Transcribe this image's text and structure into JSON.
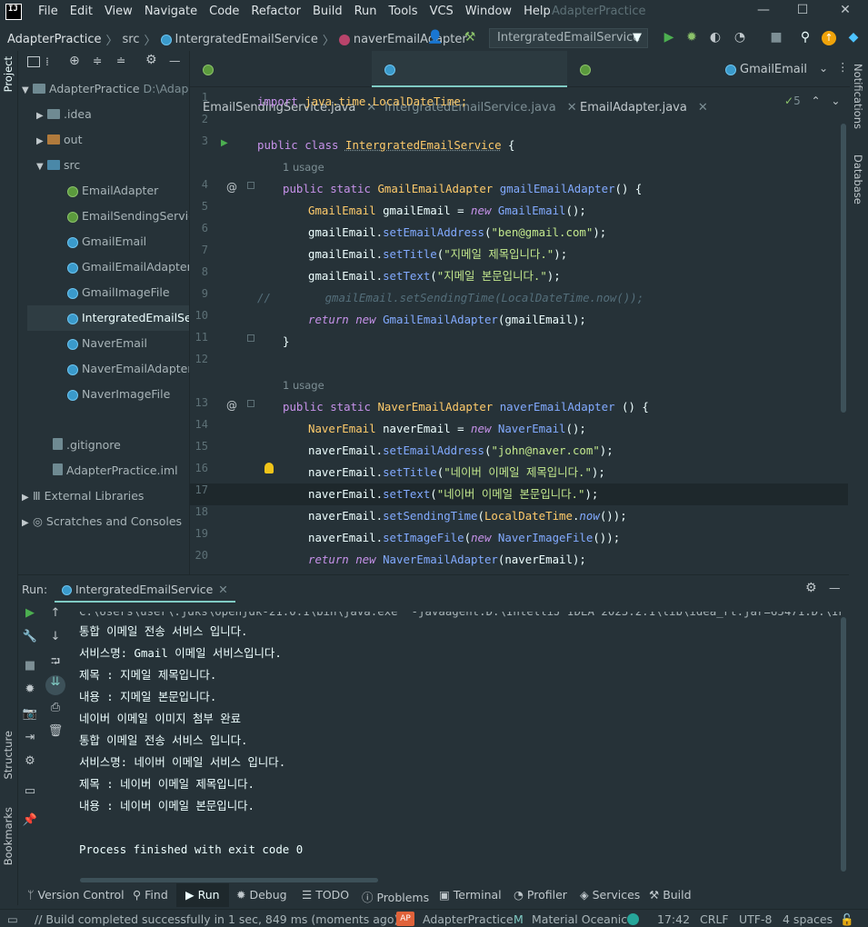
{
  "menubar": {
    "logo": "IJ",
    "items": [
      "File",
      "Edit",
      "View",
      "Navigate",
      "Code",
      "Refactor",
      "Build",
      "Run",
      "Tools",
      "VCS",
      "Window",
      "Help"
    ],
    "app_title": "AdapterPractice"
  },
  "breadcrumb": {
    "project": "AdapterPractice",
    "src": "src",
    "class": "IntergratedEmailService",
    "method": "naverEmailAdapter"
  },
  "run_config": {
    "label": "IntergratedEmailService"
  },
  "left_strip": {
    "project": "Project",
    "structure": "Structure",
    "bookmarks": "Bookmarks"
  },
  "right_strip": {
    "notifications": "Notifications",
    "database": "Database"
  },
  "project_tree": {
    "root": "AdapterPractice",
    "root_path": "D:\\Adap",
    "idea": ".idea",
    "out": "out",
    "src": "src",
    "files": [
      {
        "name": "EmailAdapter",
        "kind": "interface"
      },
      {
        "name": "EmailSendingService",
        "kind": "interface"
      },
      {
        "name": "GmailEmail",
        "kind": "class"
      },
      {
        "name": "GmailEmailAdapter",
        "kind": "class"
      },
      {
        "name": "GmailImageFile",
        "kind": "class"
      },
      {
        "name": "IntergratedEmailServic",
        "kind": "class"
      },
      {
        "name": "NaverEmail",
        "kind": "class"
      },
      {
        "name": "NaverEmailAdapter",
        "kind": "class"
      },
      {
        "name": "NaverImageFile",
        "kind": "class"
      }
    ],
    "gitignore": ".gitignore",
    "iml": "AdapterPractice.iml",
    "ext_libs": "External Libraries",
    "scratches": "Scratches and Consoles"
  },
  "tabs": [
    {
      "label": "EmailSendingService.java"
    },
    {
      "label": "IntergratedEmailService.java"
    },
    {
      "label": "EmailAdapter.java"
    },
    {
      "label": "GmailEmail"
    }
  ],
  "editor": {
    "inspection_count": "5",
    "line_numbers": [
      "1",
      "2",
      "3",
      "4",
      "5",
      "6",
      "7",
      "8",
      "9",
      "10",
      "11",
      "12",
      "13",
      "14",
      "15",
      "16",
      "17",
      "18",
      "19",
      "20"
    ],
    "usage_hint": "1 usage",
    "lines": {
      "l1a": "import ",
      "l1b": "java.time.LocalDateTime;",
      "l3a": "public class ",
      "l3b": "IntergratedEmailService",
      "l3c": " {",
      "l4a": "public static ",
      "l4b": "GmailEmailAdapter ",
      "l4c": "gmailEmailAdapter",
      "l4d": "() {",
      "l5a": "GmailEmail ",
      "l5b": "gmailEmail = ",
      "l5c": "new ",
      "l5d": "GmailEmail",
      "l5e": "();",
      "l6a": "gmailEmail.",
      "l6b": "setEmailAddress",
      "l6c": "(",
      "l6d": "\"ben@gmail.com\"",
      "l6e": ");",
      "l7a": "gmailEmail.",
      "l7b": "setTitle",
      "l7c": "(",
      "l7d": "\"지메일 제목입니다.\"",
      "l7e": ");",
      "l8a": "gmailEmail.",
      "l8b": "setText",
      "l8c": "(",
      "l8d": "\"지메일 본문입니다.\"",
      "l8e": ");",
      "l9": "//        gmailEmail.setSendingTime(LocalDateTime.now());",
      "l10a": "return ",
      "l10b": "new ",
      "l10c": "GmailEmailAdapter",
      "l10d": "(gmailEmail);",
      "l11": "}",
      "l13a": "public static ",
      "l13b": "NaverEmailAdapter ",
      "l13c": "naverEmailAdapter",
      "l13d": " () {",
      "l14a": "NaverEmail ",
      "l14b": "naverEmail = ",
      "l14c": "new ",
      "l14d": "NaverEmail",
      "l14e": "();",
      "l15a": "naverEmail.",
      "l15b": "setEmailAddress",
      "l15c": "(",
      "l15d": "\"john@naver.com\"",
      "l15e": ");",
      "l16a": "naverEmail.",
      "l16b": "setTitle",
      "l16c": "(",
      "l16d": "\"네이버 이메일 제목입니다.\"",
      "l16e": ");",
      "l17a": "naverEmail.",
      "l17b": "setText",
      "l17c": "(",
      "l17d": "\"네이버 이메일 본문입니다.\"",
      "l17e": ");",
      "l18a": "naverEmail.",
      "l18b": "setSendingTime",
      "l18c": "(",
      "l18d": "LocalDateTime",
      "l18e": ".",
      "l18f": "now",
      "l18g": "());",
      "l19a": "naverEmail.",
      "l19b": "setImageFile",
      "l19c": "(",
      "l19d": "new ",
      "l19e": "NaverImageFile",
      "l19f": "());",
      "l20a": "return ",
      "l20b": "new ",
      "l20c": "NaverEmailAdapter",
      "l20d": "(naverEmail);"
    }
  },
  "run_panel": {
    "run_label": "Run:",
    "tab_label": "IntergratedEmailService",
    "console": [
      "C:\\Users\\user\\.jdks\\openjdk-21.0.1\\bin\\java.exe \"-javaagent:D:\\IntelliJ IDEA 2023.2.1\\lib\\idea_rt.jar=65471:D:\\IntelliJ",
      "통합 이메일 전송 서비스 입니다.",
      "서비스명: Gmail 이메일 서비스입니다.",
      "제목 : 지메일 제목입니다.",
      "내용 : 지메일 본문입니다.",
      "네이버 이메일 이미지 첨부 완료",
      "통합 이메일 전송 서비스 입니다.",
      "서비스명: 네이버 이메일 서비스 입니다.",
      "제목 : 네이버 이메일 제목입니다.",
      "내용 : 네이버 이메일 본문입니다.",
      "",
      "Process finished with exit code 0"
    ]
  },
  "bottom_tabs": [
    "Version Control",
    "Find",
    "Run",
    "Debug",
    "TODO",
    "Problems",
    "Terminal",
    "Profiler",
    "Services",
    "Build"
  ],
  "statusbar": {
    "message": "// Build completed successfully in 1 sec, 849 ms (moments ago)",
    "project_badge": "AP",
    "project": "AdapterPractice",
    "theme": "Material Oceanic",
    "time": "17:42",
    "line_sep": "CRLF",
    "encoding": "UTF-8",
    "indent": "4 spaces"
  },
  "colors": {
    "accent": "#80cbc4",
    "background": "#263238",
    "keyword": "#c792ea",
    "type": "#ffcb6b",
    "string": "#c3e88d",
    "function": "#82aaff"
  }
}
